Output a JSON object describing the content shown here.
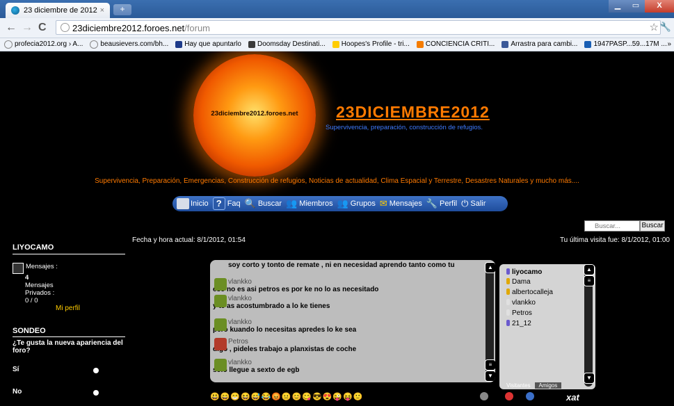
{
  "browser": {
    "tab_title": "23 diciembre de 2012",
    "tab_close": "×",
    "new_tab": "+",
    "url_host": "23diciembre2012.foroes.net",
    "url_path": "/forum",
    "back": "←",
    "forward": "→",
    "reload": "C",
    "star": "☆",
    "wrench": "🔧",
    "min": "▁",
    "max": "▭",
    "close": "X",
    "bookmarks": [
      {
        "label": "profecia2012.org › A...",
        "color": "#ffffff"
      },
      {
        "label": "beausievers.com/bh...",
        "color": "#ffffff"
      },
      {
        "label": "Hay que apuntarlo",
        "color": "#1e3b8a"
      },
      {
        "label": "Doomsday Destinati...",
        "color": "#3a3a3a"
      },
      {
        "label": "Hoopes's Profile - tri...",
        "color": "#ffcc00"
      },
      {
        "label": "CONCIENCIA CRITI...",
        "color": "#f57c00"
      },
      {
        "label": "Arrastra para cambi...",
        "color": "#3b5998"
      },
      {
        "label": "1947PASP...59...17M ...",
        "color": "#1a5fb4"
      }
    ],
    "bookmarks_more": "»"
  },
  "header": {
    "sun_text": "23diciembre2012.foroes.net",
    "title": "23DICIEMBRE2012",
    "subtitle": "Supervivencia, preparación, construcción de refugios.",
    "tagline": "Supervivencia, Preparación, Emergencias, Construcción de refugios, Noticias de actualidad, Clima Espacial y Terrestre, Desastres Naturales y mucho más...."
  },
  "menu": {
    "inicio": "Inicio",
    "faq": "Faq",
    "buscar": "Buscar",
    "miembros": "Miembros",
    "grupos": "Grupos",
    "mensajes": "Mensajes",
    "perfil": "Perfil",
    "salir": "Salir"
  },
  "search": {
    "placeholder": "Buscar...",
    "button": "Buscar"
  },
  "info": {
    "date_now": "Fecha y hora actual: 8/1/2012, 01:54",
    "last_visit": "Tu última visita fue: 8/1/2012, 01:00"
  },
  "sidebar": {
    "username": "LIYOCAMO",
    "messages_label": "Mensajes :",
    "messages_count": "4",
    "private_label_1": "Mensajes",
    "private_label_2": "Privados :",
    "private_count": "0 / 0",
    "my_profile": "Mi perfil",
    "poll_title": "SONDEO",
    "poll_question": "¿Te gusta la nueva apariencia del foro?",
    "option_yes": "Sí",
    "option_no": "No"
  },
  "chat": {
    "messages": [
      {
        "user": "",
        "text": "soy corto y tonto de remate , ni en necesidad aprendo tanto como tu"
      },
      {
        "user": "vlankko",
        "text": "eso no es asi petros es por ke no lo as necesitado"
      },
      {
        "user": "vlankko",
        "text": "y te as acostumbrado a lo ke tienes"
      },
      {
        "user": "vlankko",
        "text": "pero kuando lo necesitas apredes lo ke sea"
      },
      {
        "user": "Petros",
        "text": "digo , pideles trabajo a planxistas de coche"
      },
      {
        "user": "vlankko",
        "text": "solo llegue a sexto de egb"
      }
    ],
    "users": [
      {
        "name": "liyocamo",
        "color": "#6a5acd"
      },
      {
        "name": "Dama",
        "color": "#e0a800"
      },
      {
        "name": "albertocalleja",
        "color": "#e0a800"
      },
      {
        "name": "vlankko",
        "color": "#e0e0e0"
      },
      {
        "name": "Petros",
        "color": "#e0e0e0"
      },
      {
        "name": "21_12",
        "color": "#6a5acd"
      }
    ],
    "tab_visitors": "Visitantes",
    "tab_friends": "Amigos",
    "emoji_bar": "😃😄😁😆😅😂😡😐😊😋😎😍😜😝🙂",
    "xat_label": "xat",
    "scroll_up": "▲",
    "scroll_mid": "≡",
    "scroll_down": "▼"
  }
}
